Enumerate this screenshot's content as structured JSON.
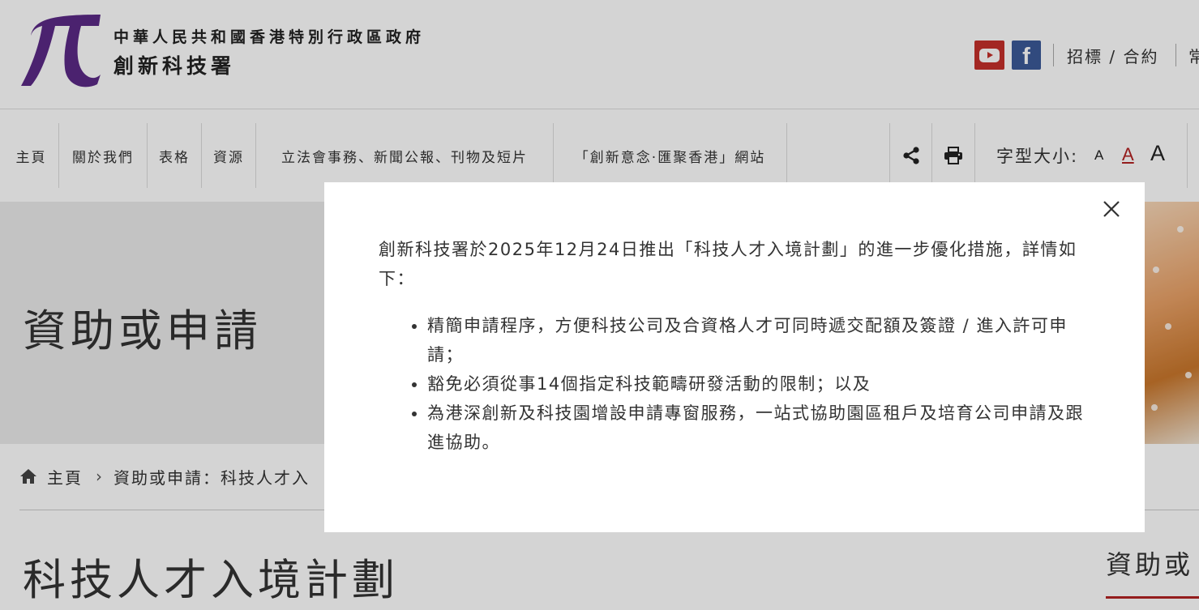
{
  "header": {
    "org_name_zh_line1": "中華人民共和國香港特別行政區政府",
    "org_name_zh_line2": "創新科技署",
    "youtube_icon": "youtube-icon",
    "facebook_icon": "facebook-icon",
    "tender_link": "招標 / 合約",
    "overflow_link": "常"
  },
  "nav": {
    "items": [
      {
        "label": "主頁"
      },
      {
        "label": "關於我們"
      },
      {
        "label": "表格"
      },
      {
        "label": "資源"
      },
      {
        "label": "立法會事務、新聞公報、刊物及短片"
      },
      {
        "label": "「創新意念‧匯聚香港」網站"
      }
    ],
    "share_icon": "share-icon",
    "print_icon": "print-icon",
    "font_size_label": "字型大小:",
    "font_small": "A",
    "font_medium": "A",
    "font_large": "A"
  },
  "banner": {
    "title": "資助或申請"
  },
  "breadcrumb": {
    "home": "主頁",
    "current": "資助或申請：科技人才入"
  },
  "page_title": "科技人才入境計劃",
  "sidebar_heading": "資助或",
  "modal": {
    "intro": "創新科技署於2025年12月24日推出「科技人才入境計劃」的進一步優化措施，詳情如下：",
    "bullets": [
      "精簡申請程序，方便科技公司及合資格人才可同時遞交配額及簽證 / 進入許可申請；",
      "豁免必須從事14個指定科技範疇研發活動的限制；以及",
      "為港深創新及科技園增設申請專窗服務，一站式協助園區租戶及培育公司申請及跟進協助。"
    ]
  },
  "colors": {
    "brand_purple": "#5b2a86",
    "accent_red": "#b22222",
    "youtube_red": "#c4302b",
    "facebook_blue": "#3b5998"
  }
}
